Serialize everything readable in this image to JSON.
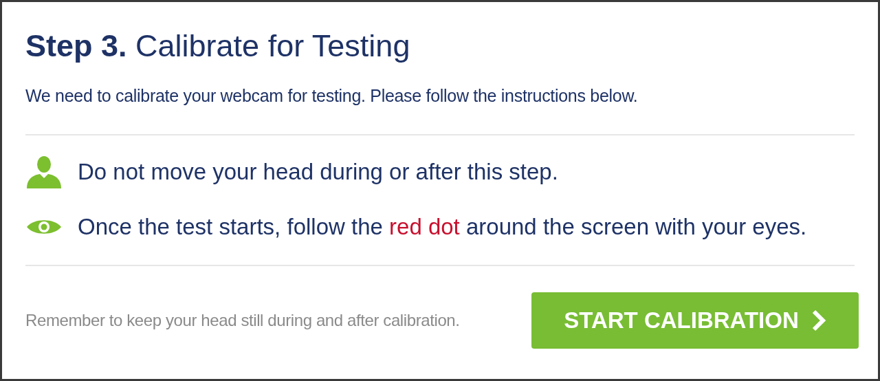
{
  "title": "**Step 3.** Calibrate for Testing",
  "intro": "We need to calibrate your webcam for testing. Please follow the instructions below.",
  "instructions": [
    {
      "kind": "person",
      "segments": [
        {
          "text": "Do not move your head during or after this step.",
          "highlight": false
        }
      ]
    },
    {
      "kind": "eye",
      "segments": [
        {
          "text": "Once the test starts, follow the ",
          "highlight": false
        },
        {
          "text": "red dot",
          "highlight": true
        },
        {
          "text": " around the screen with your eyes.",
          "highlight": false
        }
      ]
    }
  ],
  "reminder": "Remember to keep your head still during and after calibration.",
  "button": {
    "label": "START CALIBRATION"
  }
}
